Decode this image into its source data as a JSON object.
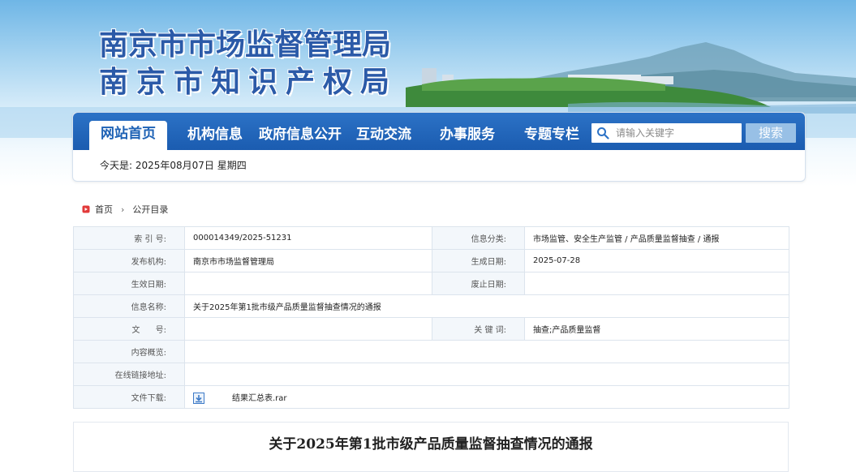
{
  "banner": {
    "title_line1": "南京市市场监督管理局",
    "title_line2": "南京市知识产权局"
  },
  "nav": {
    "items": [
      "网站首页",
      "机构信息",
      "政府信息公开",
      "互动交流",
      "办事服务",
      "专题专栏"
    ],
    "active_index": 0,
    "search_placeholder": "请输入关键字",
    "search_button": "搜索"
  },
  "date_line": "今天是: 2025年08月07日 星期四",
  "breadcrumb": {
    "home": "首页",
    "current": "公开目录"
  },
  "info": {
    "index_label": "索 引 号:",
    "index_value": "000014349/2025-51231",
    "category_label": "信息分类:",
    "category_value": "市场监管、安全生产监管 / 产品质量监督抽查 / 通报",
    "publisher_label": "发布机构:",
    "publisher_value": "南京市市场监督管理局",
    "created_label": "生成日期:",
    "created_value": "2025-07-28",
    "effective_label": "生效日期:",
    "effective_value": "",
    "expired_label": "废止日期:",
    "expired_value": "",
    "name_label": "信息名称:",
    "name_value": "关于2025年第1批市级产品质量监督抽查情况的通报",
    "docno_label": "文      号:",
    "docno_value": "",
    "keywords_label": "关 键 词:",
    "keywords_value": "抽查;产品质量监督",
    "summary_label": "内容概览:",
    "summary_value": "",
    "link_label": "在线链接地址:",
    "link_value": "",
    "download_label": "文件下载:",
    "download_value": "结果汇总表.rar"
  },
  "article": {
    "title": "关于2025年第1批市级产品质量监督抽查情况的通报"
  },
  "colors": {
    "nav_blue": "#1e62b5",
    "title_blue": "#2b5aa8",
    "search_button": "#98c0e6",
    "label_bg": "#f3f7fb"
  }
}
